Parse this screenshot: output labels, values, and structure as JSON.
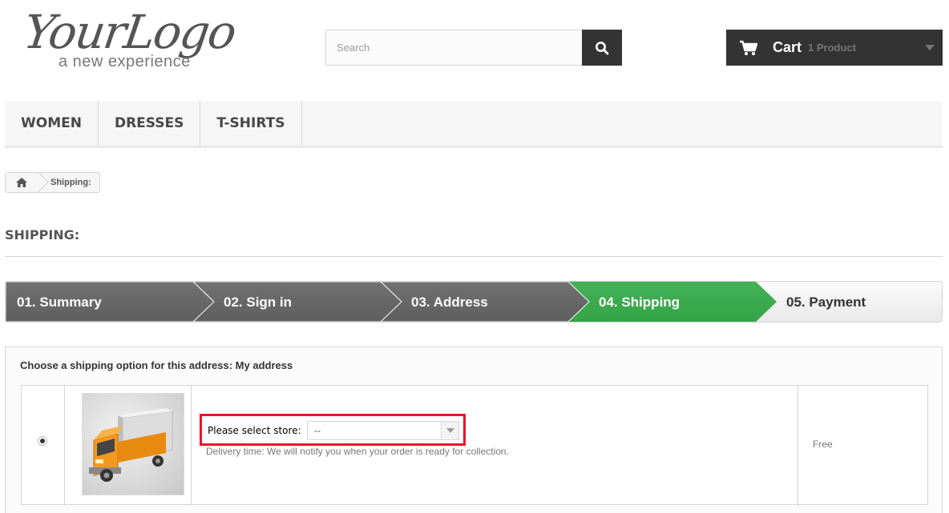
{
  "header": {
    "logo_main": "YourLogo",
    "logo_sub": "a new experience",
    "search_placeholder": "Search",
    "cart_title": "Cart",
    "cart_count": "1 Product"
  },
  "menu": {
    "items": [
      {
        "label": "WOMEN"
      },
      {
        "label": "DRESSES"
      },
      {
        "label": "T-SHIRTS"
      }
    ]
  },
  "breadcrumb": {
    "current": "Shipping:"
  },
  "page": {
    "title": "SHIPPING:"
  },
  "steps": [
    {
      "label": "01. Summary",
      "state": "done"
    },
    {
      "label": "02. Sign in",
      "state": "done"
    },
    {
      "label": "03. Address",
      "state": "done"
    },
    {
      "label": "04. Shipping",
      "state": "current"
    },
    {
      "label": "05. Payment",
      "state": "todo"
    }
  ],
  "shipping": {
    "heading": "Choose a shipping option for this address: My address",
    "store_label": "Please select store:",
    "store_value": "--",
    "delivery_text": "Delivery time: We will notify you when your order is ready for collection.",
    "price": "Free"
  },
  "colors": {
    "dark": "#333333",
    "step_done": "#666666",
    "step_current": "#3aaa54",
    "highlight": "#e2182b"
  }
}
